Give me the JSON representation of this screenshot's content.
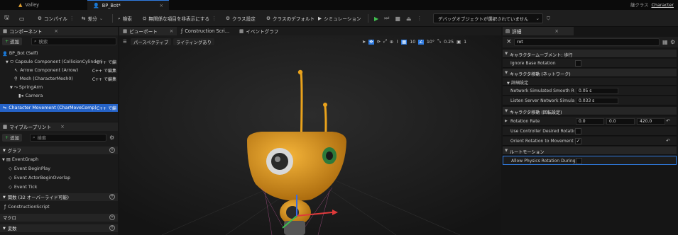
{
  "window": {
    "tabs": [
      {
        "label": "Valley"
      },
      {
        "label": "BP_Bot*"
      }
    ],
    "right_text": "継クラス",
    "right_link": "Character"
  },
  "toolbar": {
    "compile": "コンパイル",
    "diff": "差分",
    "find": "検索",
    "hide_unrelated": "無関係な項目を非表示にする",
    "class_settings": "クラス設定",
    "class_defaults": "クラスのデフォルト",
    "simulation": "シミュレーション",
    "debug_object": "デバッグオブジェクトが選択されていません"
  },
  "components": {
    "tab_label": "コンポーネント",
    "add_label": "追加",
    "search_placeholder": "検索",
    "tree": [
      {
        "label": "BP_Bot (Self)",
        "cpp": ""
      },
      {
        "label": "Capsule Component (CollisionCylinder)",
        "cpp": "C++ で編"
      },
      {
        "label": "Arrow Component (Arrow)",
        "cpp": "C++ で編集"
      },
      {
        "label": "Mesh (CharacterMesh0)",
        "cpp": "C++ で編集"
      },
      {
        "label": "SpringArm",
        "cpp": ""
      },
      {
        "label": "Camera",
        "cpp": ""
      },
      {
        "label": "Character Movement (CharMoveComp)",
        "cpp": "C++ で編"
      }
    ]
  },
  "myblueprint": {
    "tab_label": "マイブループリント",
    "add_label": "追加",
    "search_placeholder": "検索",
    "graph_section": "グラフ",
    "event_graph": "EventGraph",
    "events": [
      "Event BeginPlay",
      "Event ActorBeginOverlap",
      "Event Tick"
    ],
    "functions_section": "関数 (32 オーバーライド可能)",
    "construction_script": "ConstructionScript",
    "macros_section": "マクロ",
    "variables_section": "変数"
  },
  "viewport": {
    "tabs": [
      {
        "label": "ビューポート"
      },
      {
        "label": "Construction Scri..."
      },
      {
        "label": "イベントグラフ"
      }
    ],
    "perspective": "パースペクティブ",
    "lighting": "ライティングあり",
    "grid_snap": "10",
    "rotation_snap": "10°",
    "scale_snap": "0.25",
    "camera_speed": "1"
  },
  "details": {
    "tab_label": "詳細",
    "search_value": "rot",
    "sections": [
      {
        "title": "キャラクタームーブメント: 歩行"
      },
      {
        "title": "キャラクタ移動 (ネットワーク)"
      },
      {
        "title": "キャラクタ移動 (回転設定)"
      },
      {
        "title": "ルートモーション"
      }
    ],
    "ignore_base_rotation": "Ignore Base Rotation",
    "advanced": "詳細設定",
    "net_smooth_label": "Network Simulated Smooth Rot...",
    "net_smooth_value": "0.05 s",
    "listen_server_label": "Listen Server Network Simulate...",
    "listen_server_value": "0.033 s",
    "rotation_rate_label": "Rotation Rate",
    "rotation_rate_x": "0.0",
    "rotation_rate_y": "0.0",
    "rotation_rate_z": "420.0",
    "use_controller_label": "Use Controller Desired Rotation",
    "orient_label": "Orient Rotation to Movement",
    "orient_checked": true,
    "allow_physics_label": "Allow Physics Rotation During A..."
  },
  "colors": {
    "accent_blue": "#2f7be0",
    "play_green": "#3fbf4f",
    "selection": "#2563c8",
    "robot_body": "#e9a21c"
  }
}
